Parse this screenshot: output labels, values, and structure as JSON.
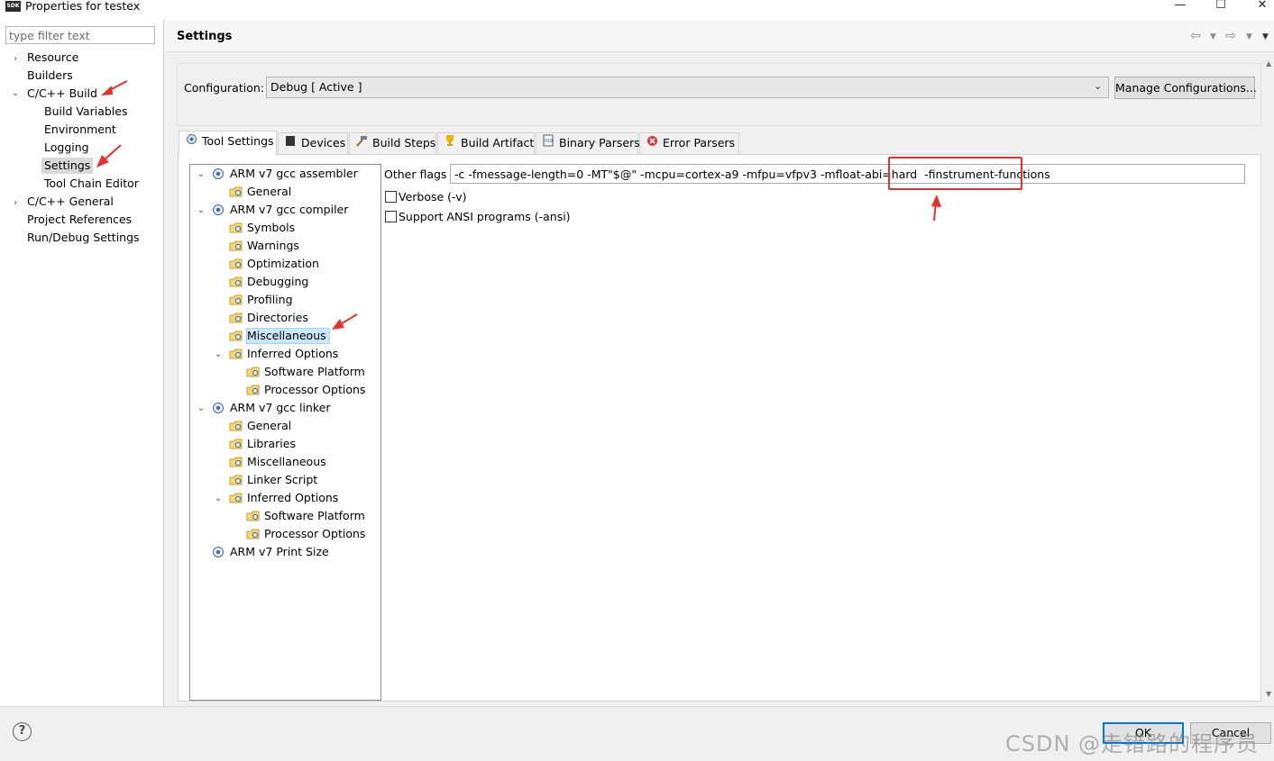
{
  "window": {
    "title": "Properties for testex",
    "icon": "SDK",
    "min_icon": "—",
    "max_icon": "☐",
    "close_icon": "✕"
  },
  "filter": {
    "placeholder": "type filter text"
  },
  "nav": {
    "items": [
      {
        "label": "Resource"
      },
      {
        "label": "Builders"
      },
      {
        "label": "C/C++ Build"
      },
      {
        "label": "Build Variables"
      },
      {
        "label": "Environment"
      },
      {
        "label": "Logging"
      },
      {
        "label": "Settings"
      },
      {
        "label": "Tool Chain Editor"
      },
      {
        "label": "C/C++ General"
      },
      {
        "label": "Project References"
      },
      {
        "label": "Run/Debug Settings"
      }
    ],
    "selected": "Settings"
  },
  "header": {
    "title": "Settings"
  },
  "configuration": {
    "label": "Configuration:",
    "value": "Debug  [ Active ]",
    "manage_label": "Manage Configurations..."
  },
  "tabs": [
    {
      "label": "Tool Settings",
      "active": true
    },
    {
      "label": "Devices"
    },
    {
      "label": "Build Steps"
    },
    {
      "label": "Build Artifact"
    },
    {
      "label": "Binary Parsers"
    },
    {
      "label": "Error Parsers"
    }
  ],
  "tool_tree": {
    "items": [
      {
        "label": "ARM v7 gcc assembler"
      },
      {
        "label": "General"
      },
      {
        "label": "ARM v7 gcc compiler"
      },
      {
        "label": "Symbols"
      },
      {
        "label": "Warnings"
      },
      {
        "label": "Optimization"
      },
      {
        "label": "Debugging"
      },
      {
        "label": "Profiling"
      },
      {
        "label": "Directories"
      },
      {
        "label": "Miscellaneous"
      },
      {
        "label": "Inferred Options"
      },
      {
        "label": "Software Platform"
      },
      {
        "label": "Processor Options"
      },
      {
        "label": "ARM v7 gcc linker"
      },
      {
        "label": "General"
      },
      {
        "label": "Libraries"
      },
      {
        "label": "Miscellaneous"
      },
      {
        "label": "Linker Script"
      },
      {
        "label": "Inferred Options"
      },
      {
        "label": "Software Platform"
      },
      {
        "label": "Processor Options"
      },
      {
        "label": "ARM v7 Print Size"
      }
    ],
    "selected": "Miscellaneous"
  },
  "options": {
    "other_flags_label": "Other flags",
    "other_flags_value": "-c -fmessage-length=0 -MT\"$@\" -mcpu=cortex-a9 -mfpu=vfpv3 -mfloat-abi=hard  -finstrument-functions",
    "verbose_label": "Verbose (-v)",
    "verbose_checked": false,
    "ansi_label": "Support ANSI programs (-ansi)",
    "ansi_checked": false
  },
  "buttons": {
    "ok": "OK",
    "cancel": "Cancel",
    "help": "?"
  },
  "watermark": "CSDN @走错路的程序员",
  "colors": {
    "annotation_red": "#e8302a",
    "selection_blue": "#cce8ff"
  }
}
